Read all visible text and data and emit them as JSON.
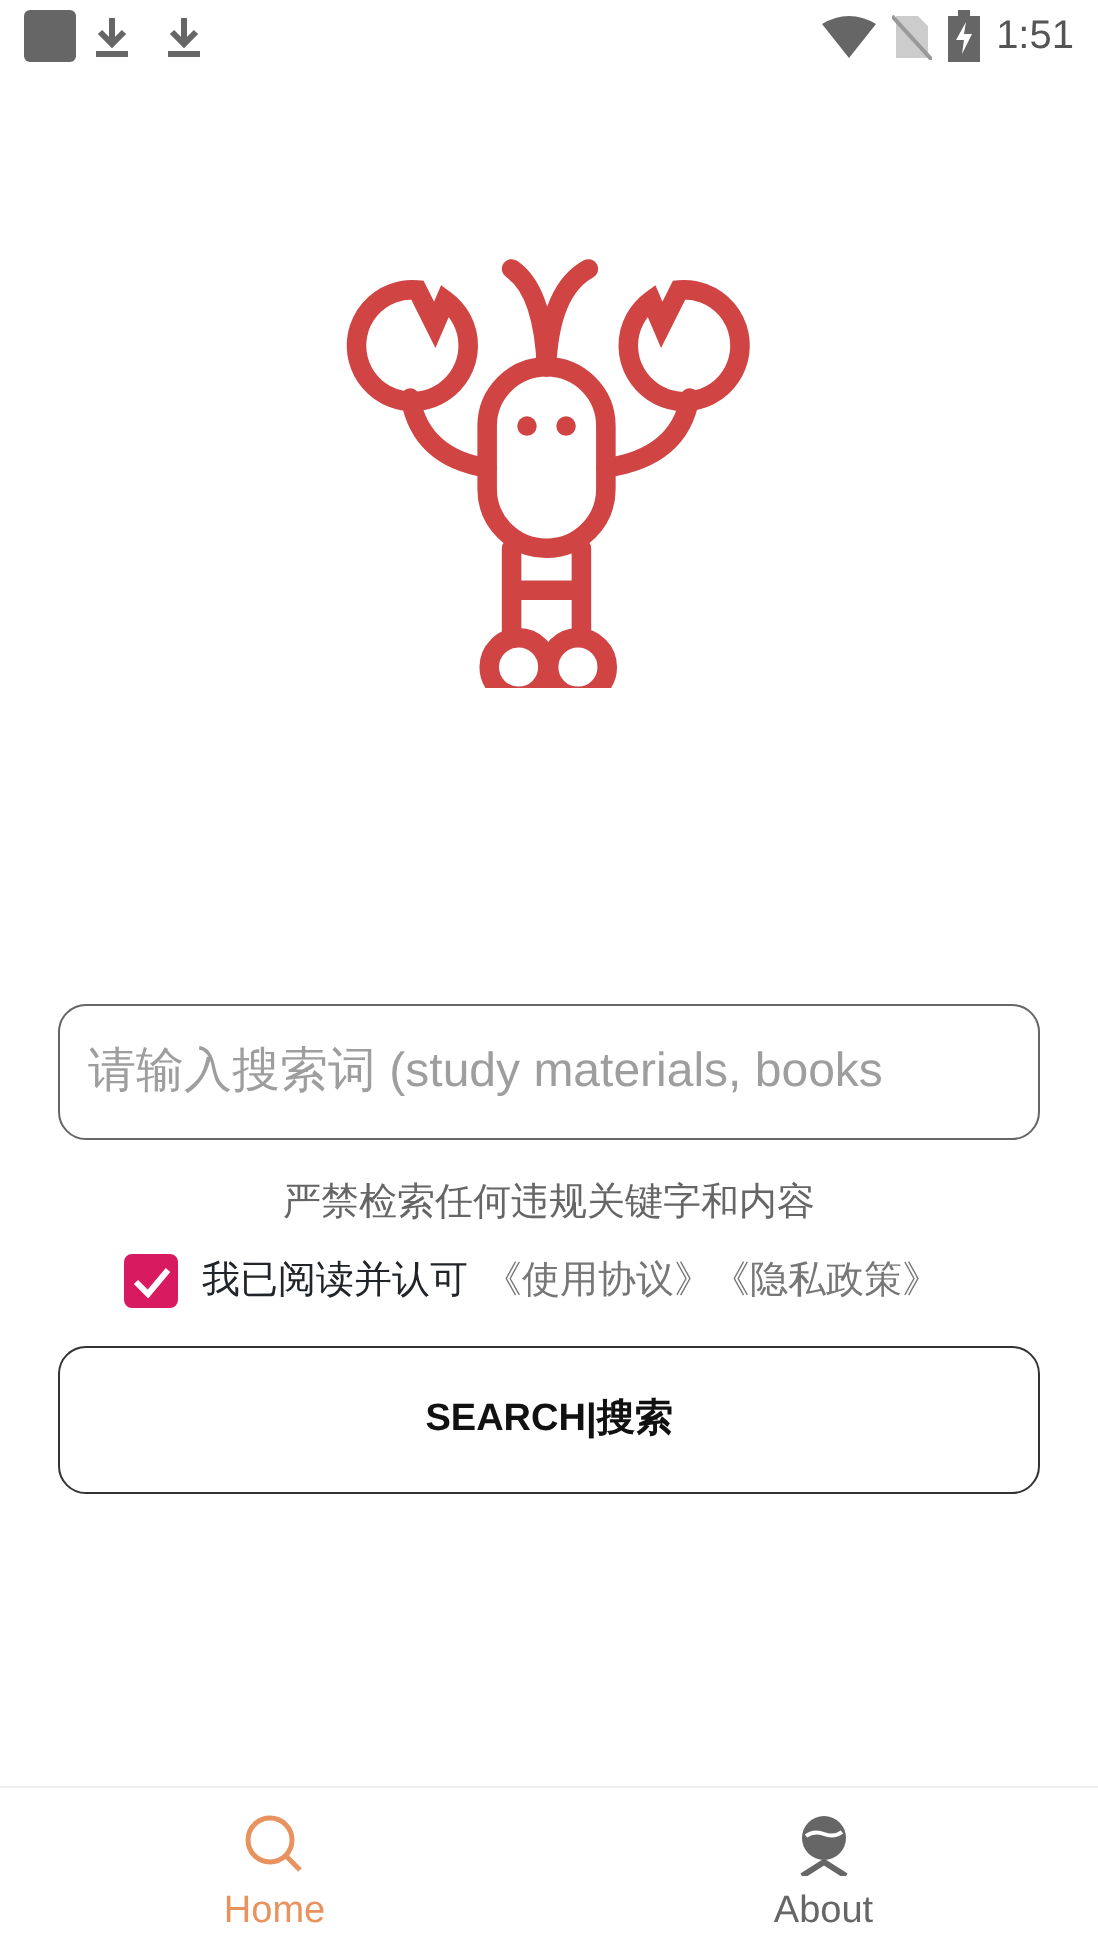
{
  "status_bar": {
    "time": "1:51"
  },
  "search": {
    "placeholder": "请输入搜索词 (study materials, books"
  },
  "notice": "严禁检索任何违规关键字和内容",
  "agreement": {
    "checked": true,
    "label": "我已阅读并认可",
    "links": [
      "《使用协议》",
      "《隐私政策》"
    ]
  },
  "search_button": "SEARCH|搜索",
  "bottom_nav": [
    {
      "kind": "home",
      "label": "Home",
      "selected": true
    },
    {
      "kind": "about",
      "label": "About",
      "selected": false
    }
  ]
}
